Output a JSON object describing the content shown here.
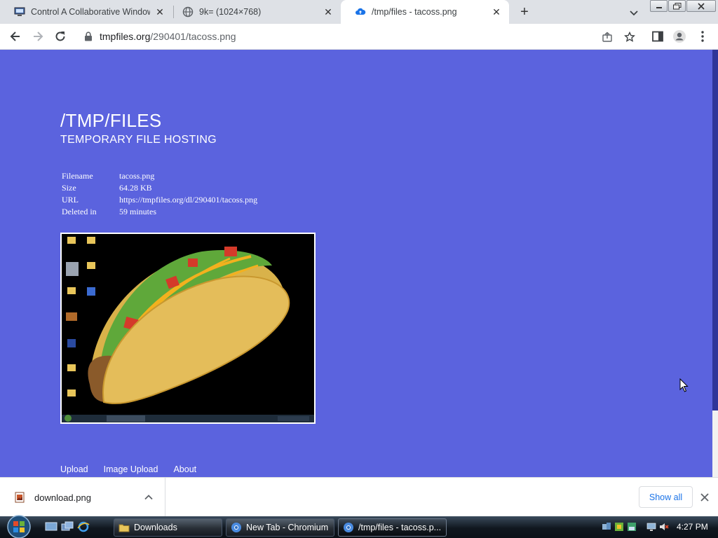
{
  "tabs": [
    {
      "title": "Control A Collaborative Windows",
      "active": false,
      "icon": "remote-desktop-icon"
    },
    {
      "title": "9k= (1024×768)",
      "active": false,
      "icon": "globe-icon"
    },
    {
      "title": "/tmp/files - tacoss.png",
      "active": true,
      "icon": "cloud-upload-icon"
    }
  ],
  "toolbar": {
    "url_host": "tmpfiles.org",
    "url_path": "/290401/tacoss.png"
  },
  "page": {
    "title": "/TMP/FILES",
    "subtitle": "TEMPORARY FILE HOSTING",
    "info": [
      {
        "label": "Filename",
        "value": "tacoss.png"
      },
      {
        "label": "Size",
        "value": "64.28 KB"
      },
      {
        "label": "URL",
        "value": "https://tmpfiles.org/dl/290401/tacoss.png"
      },
      {
        "label": "Deleted in",
        "value": "59 minutes"
      }
    ],
    "footer_links": [
      "Upload",
      "Image Upload",
      "About"
    ]
  },
  "download_bar": {
    "filename": "download.png",
    "show_all": "Show all"
  },
  "taskbar": {
    "tasks": [
      {
        "label": "Downloads",
        "active": false
      },
      {
        "label": "New Tab - Chromium",
        "active": false
      },
      {
        "label": "/tmp/files - tacoss.p...",
        "active": true
      }
    ],
    "clock": "4:27 PM"
  },
  "colors": {
    "page_bg": "#5b63de",
    "link_blue": "#1a73e8",
    "tab_strip": "#dee1e6"
  }
}
